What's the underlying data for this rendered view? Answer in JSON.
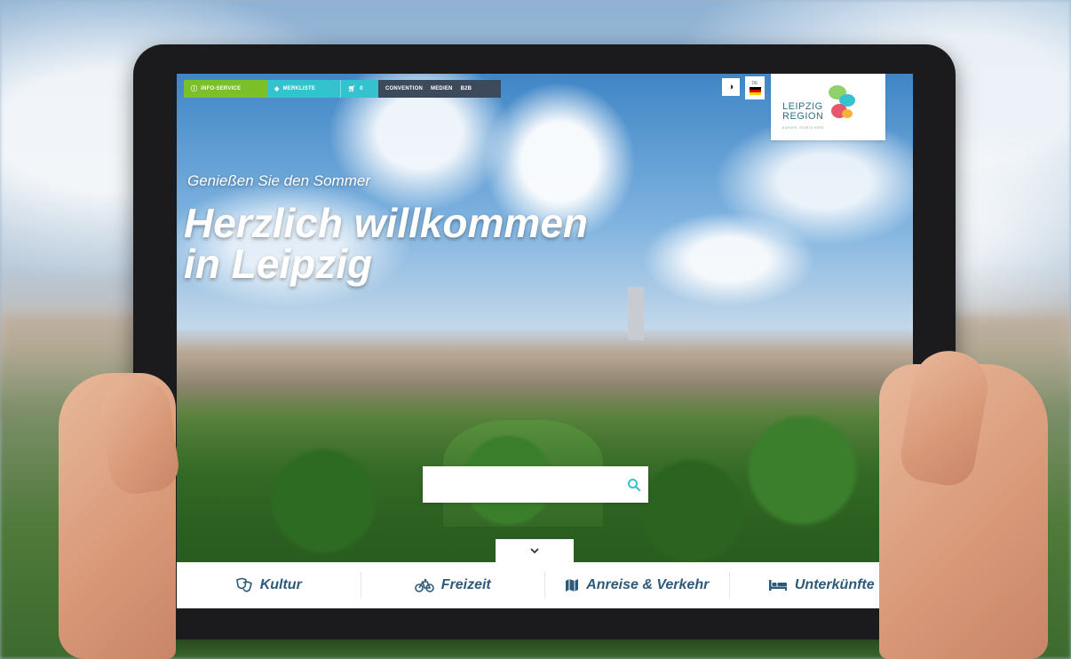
{
  "top_nav": {
    "info_service": "INFO-SERVICE",
    "merkliste": "MERKLISTE",
    "cart_count": "0",
    "convention": "CONVENTION",
    "medien": "MEDIEN",
    "b2b": "B2B"
  },
  "language": {
    "code": "DE"
  },
  "logo": {
    "line1": "LEIPZIG",
    "line2": "REGION",
    "tagline": "EUROPE. STARTS HERE."
  },
  "hero": {
    "subtitle": "Genießen Sie den Sommer",
    "title_line1": "Herzlich willkommen",
    "title_line2": "in Leipzig"
  },
  "search": {
    "placeholder": ""
  },
  "categories": [
    {
      "label": "Kultur",
      "icon": "theater-masks-icon"
    },
    {
      "label": "Freizeit",
      "icon": "bicycle-icon"
    },
    {
      "label": "Anreise & Verkehr",
      "icon": "map-icon"
    },
    {
      "label": "Unterkünfte",
      "icon": "bed-icon"
    }
  ],
  "colors": {
    "info_green": "#7bbf2a",
    "merkliste_teal": "#35c2cf",
    "nav_dark": "#3c4a5c",
    "category_text": "#2d5a7a"
  }
}
